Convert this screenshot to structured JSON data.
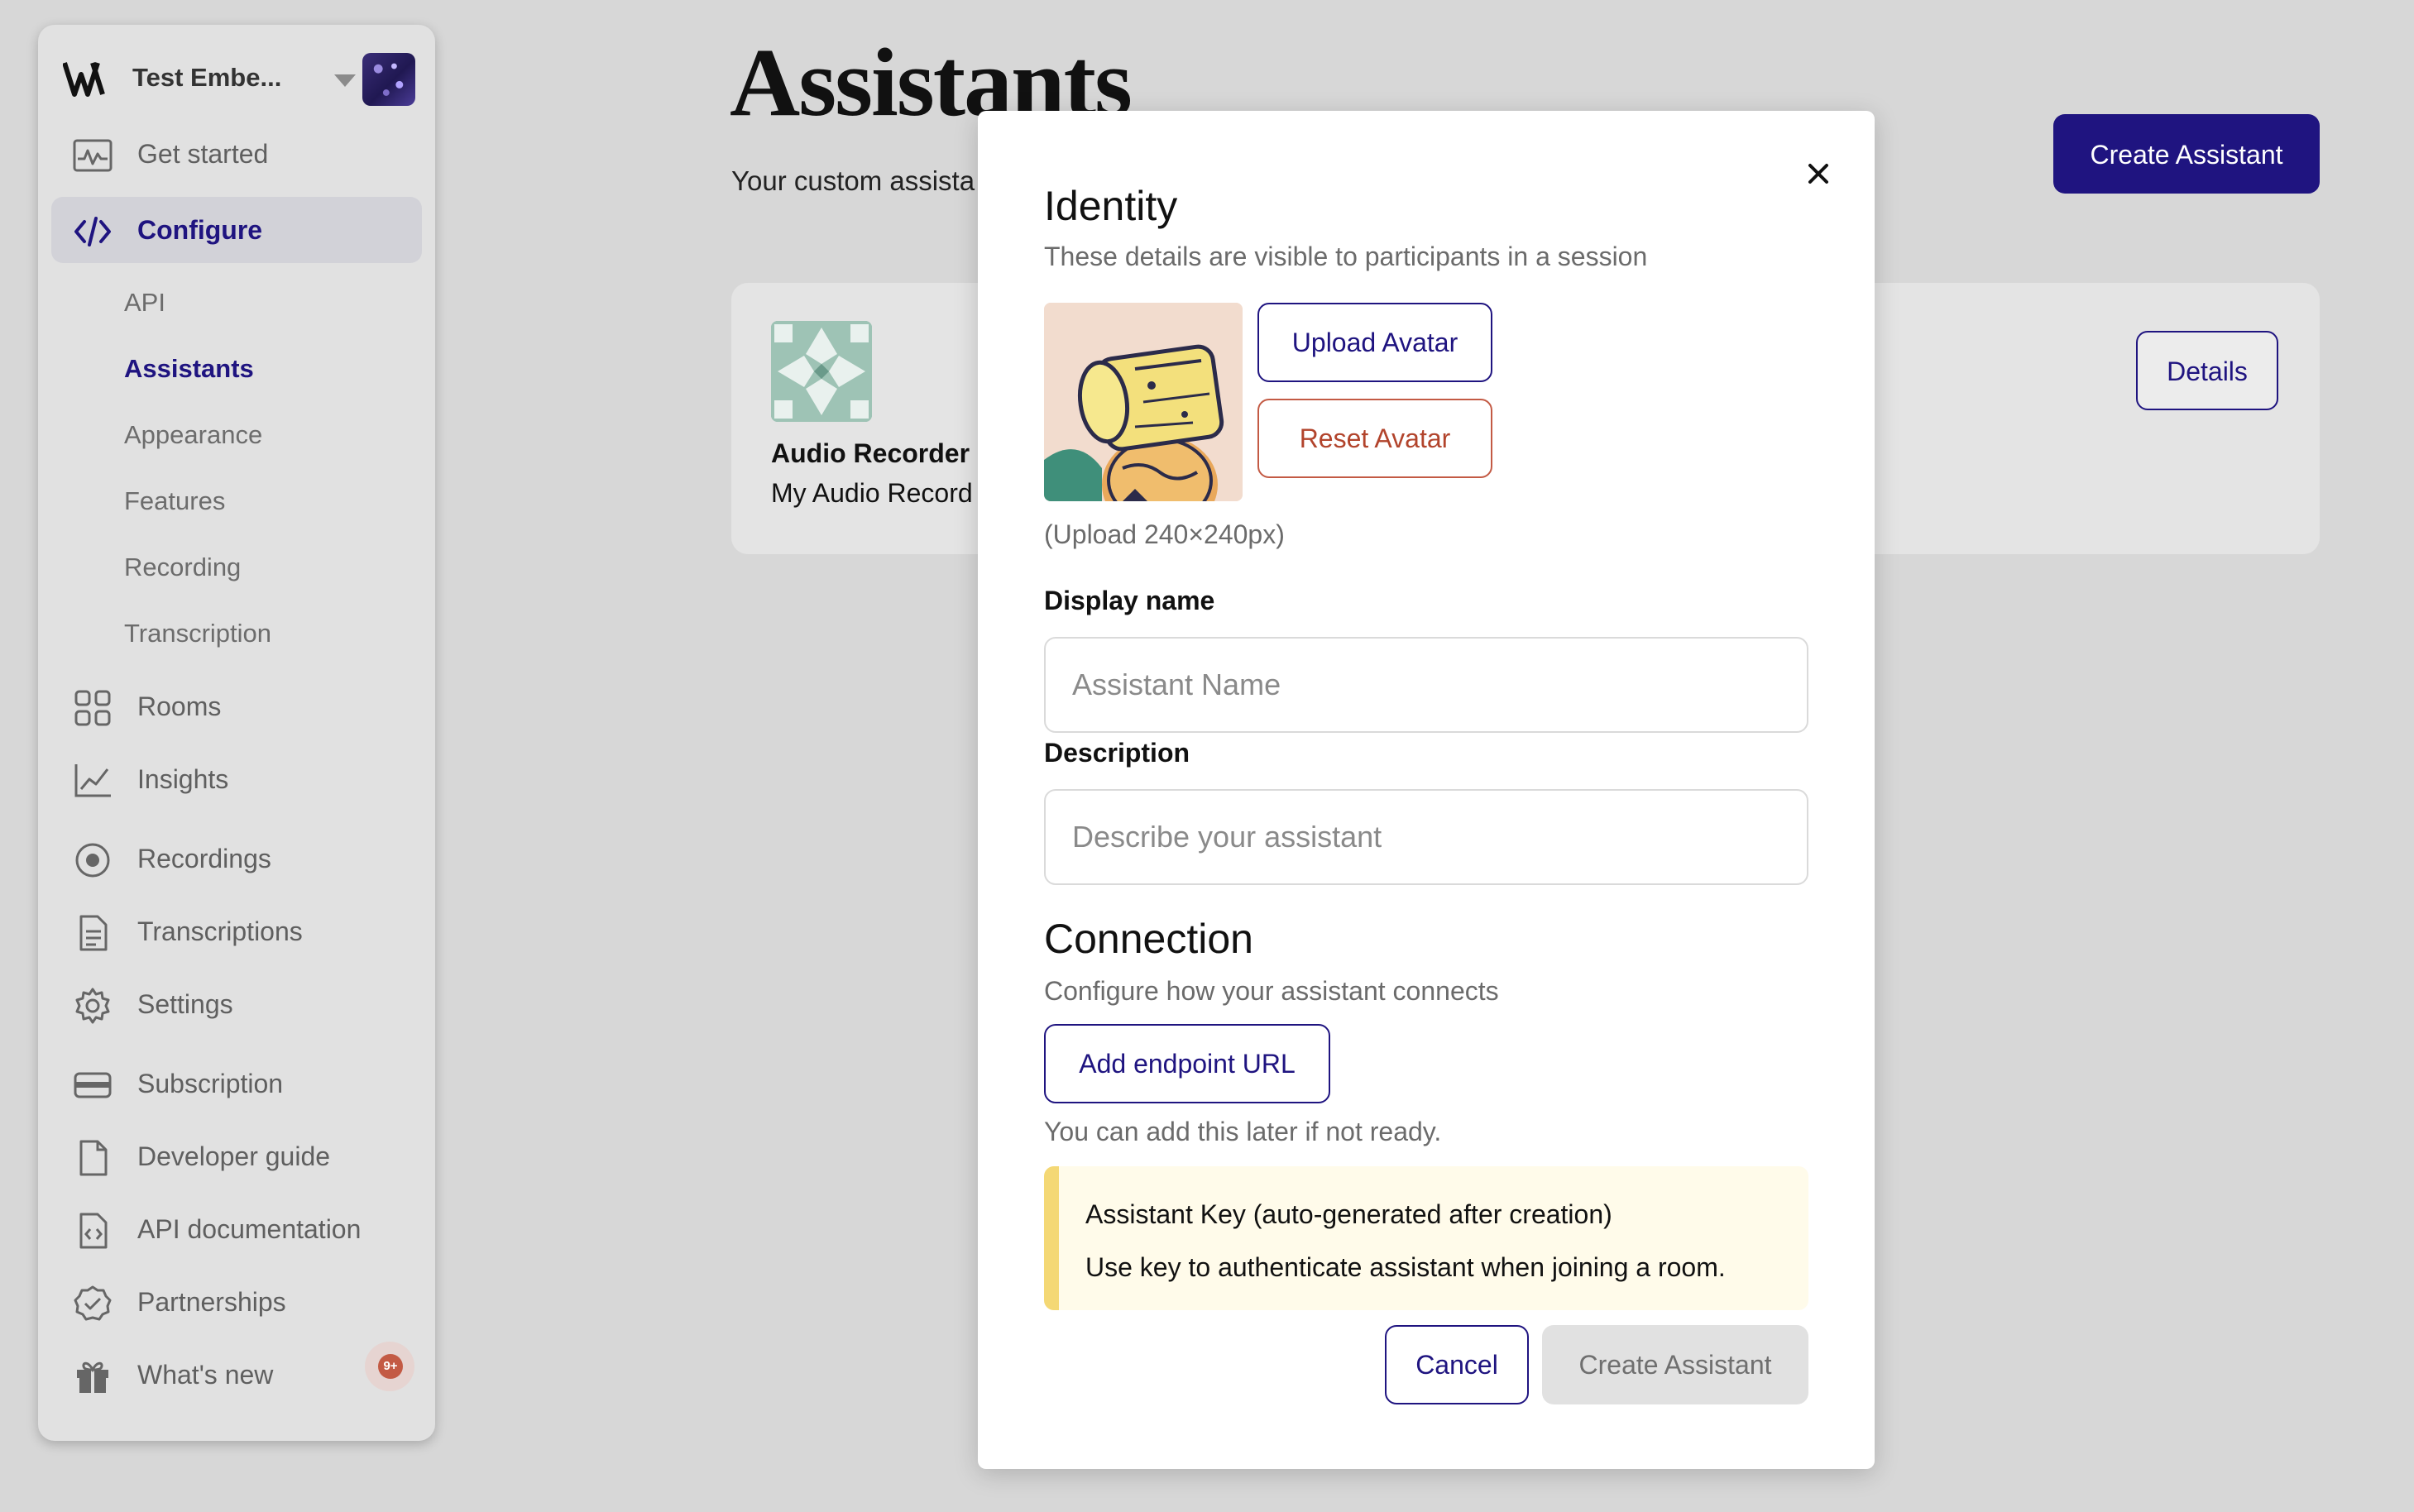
{
  "sidebar": {
    "workspace_name": "Test Embe...",
    "items": [
      {
        "label": "Get started",
        "icon": "activity-chart-icon"
      },
      {
        "label": "Configure",
        "icon": "code-icon",
        "active": true
      },
      {
        "label": "Rooms",
        "icon": "grid-icon"
      },
      {
        "label": "Insights",
        "icon": "line-chart-icon"
      },
      {
        "label": "Recordings",
        "icon": "record-icon"
      },
      {
        "label": "Transcriptions",
        "icon": "document-icon"
      },
      {
        "label": "Settings",
        "icon": "gear-icon"
      },
      {
        "label": "Subscription",
        "icon": "credit-card-icon"
      },
      {
        "label": "Developer guide",
        "icon": "file-icon"
      },
      {
        "label": "API documentation",
        "icon": "code-file-icon"
      },
      {
        "label": "Partnerships",
        "icon": "badge-check-icon"
      },
      {
        "label": "What's new",
        "icon": "gift-icon"
      }
    ],
    "configure_subitems": [
      {
        "label": "API"
      },
      {
        "label": "Assistants",
        "active": true
      },
      {
        "label": "Appearance"
      },
      {
        "label": "Features"
      },
      {
        "label": "Recording"
      },
      {
        "label": "Transcription"
      }
    ],
    "whats_new_badge": "9+"
  },
  "main": {
    "title": "Assistants",
    "subtitle": "Your custom assista",
    "create_button": "Create Assistant",
    "assistant_card": {
      "name": "Audio Recorder",
      "description": "My Audio Record",
      "details_button": "Details"
    }
  },
  "modal": {
    "identity": {
      "heading": "Identity",
      "subheading": "These details are visible to participants in a session",
      "upload_button": "Upload Avatar",
      "reset_button": "Reset Avatar",
      "upload_hint": "(Upload 240×240px)"
    },
    "display_name": {
      "label": "Display name",
      "placeholder": "Assistant Name"
    },
    "description": {
      "label": "Description",
      "placeholder": "Describe your assistant"
    },
    "connection": {
      "heading": "Connection",
      "subheading": "Configure how your assistant connects",
      "add_endpoint_button": "Add endpoint URL",
      "hint": "You can add this later if not ready."
    },
    "notice": {
      "title": "Assistant Key (auto-generated after creation)",
      "body": "Use key to authenticate assistant when joining a room."
    },
    "cancel_button": "Cancel",
    "create_button": "Create Assistant"
  },
  "colors": {
    "accent": "#1f1480",
    "danger": "#c35a44",
    "overlay_bg": "#d7d7d7",
    "notice_bg": "#fffbea",
    "notice_bar": "#f4d875"
  }
}
